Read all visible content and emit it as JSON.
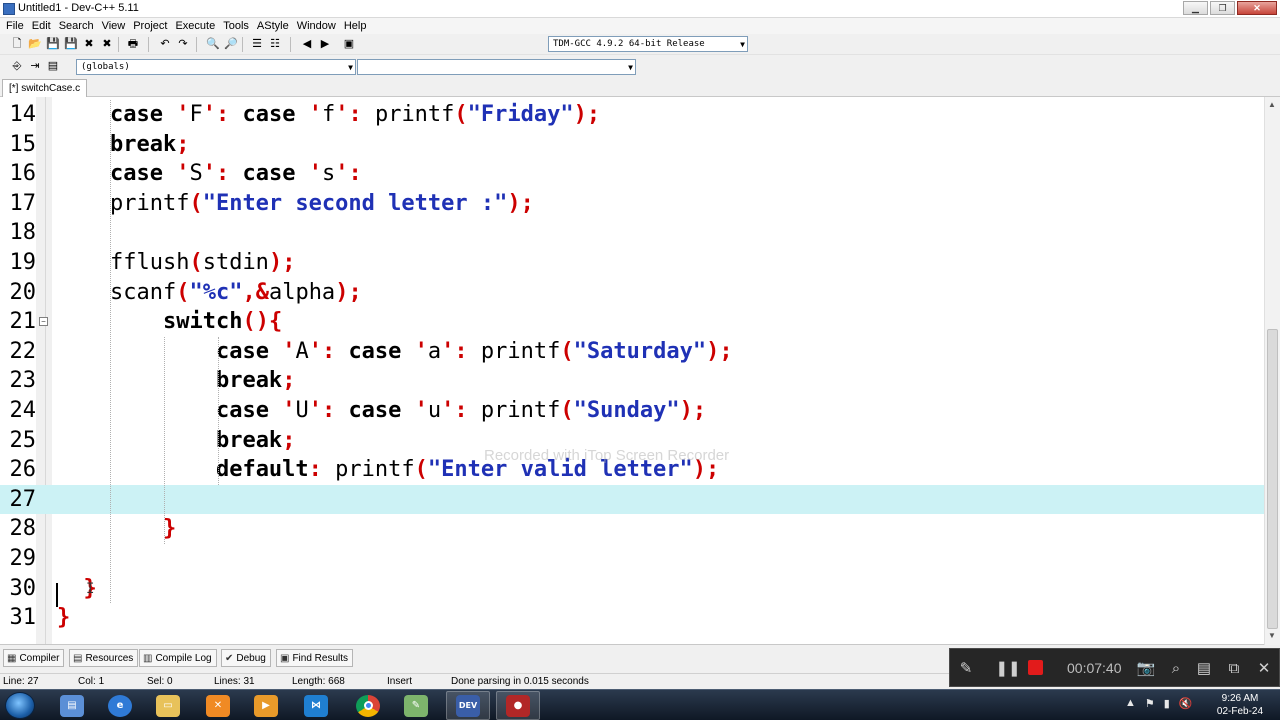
{
  "window": {
    "title": "Untitled1 - Dev-C++ 5.11"
  },
  "menu": [
    "File",
    "Edit",
    "Search",
    "View",
    "Project",
    "Execute",
    "Tools",
    "AStyle",
    "Window",
    "Help"
  ],
  "toolbar": {
    "compiler_select": "TDM-GCC 4.9.2 64-bit Release",
    "scope_select": "(globals)",
    "member_select": ""
  },
  "tab": {
    "label": "[*] switchCase.c"
  },
  "editor": {
    "current_line": 27,
    "lines": [
      {
        "n": "14",
        "text": "    case 'F': case 'f': printf(\"Friday\");"
      },
      {
        "n": "15",
        "text": "    break;"
      },
      {
        "n": "16",
        "text": "    case 'S': case 's':"
      },
      {
        "n": "17",
        "text": "    printf(\"Enter second letter :\");"
      },
      {
        "n": "18",
        "text": ""
      },
      {
        "n": "19",
        "text": "    fflush(stdin);"
      },
      {
        "n": "20",
        "text": "    scanf(\"%c\",&alpha);"
      },
      {
        "n": "21",
        "text": "        switch(){"
      },
      {
        "n": "22",
        "text": "            case 'A': case 'a': printf(\"Saturday\");"
      },
      {
        "n": "23",
        "text": "            break;"
      },
      {
        "n": "24",
        "text": "            case 'U': case 'u': printf(\"Sunday\");"
      },
      {
        "n": "25",
        "text": "            break;"
      },
      {
        "n": "26",
        "text": "            default: printf(\"Enter valid letter\");"
      },
      {
        "n": "27",
        "text": ""
      },
      {
        "n": "28",
        "text": "        }"
      },
      {
        "n": "29",
        "text": ""
      },
      {
        "n": "30",
        "text": "  }"
      },
      {
        "n": "31",
        "text": "}"
      }
    ],
    "watermark": "Recorded with iTop Screen Recorder"
  },
  "bottom_tabs": [
    "Compiler",
    "Resources",
    "Compile Log",
    "Debug",
    "Find Results"
  ],
  "recorder": {
    "time": "00:07:40"
  },
  "status": {
    "line_label": "Line:",
    "line_value": "27",
    "col_label": "Col:",
    "col_value": "1",
    "sel_label": "Sel:",
    "sel_value": "0",
    "lines_label": "Lines:",
    "lines_value": "31",
    "length_label": "Length:",
    "length_value": "668",
    "mode": "Insert",
    "message": "Done parsing in 0.015 seconds"
  },
  "taskbar": {
    "apps": [
      "explorer",
      "file",
      "ie",
      "folder",
      "xampp",
      "media",
      "vscode",
      "chrome",
      "paint",
      "devcpp",
      "recorder"
    ],
    "clock_time": "9:26 AM",
    "clock_date": "02-Feb-24"
  },
  "colors": {
    "keyword": "#000000",
    "string": "#1f31b5",
    "symbol": "#cc0000",
    "current_line": "#ccf2f5"
  }
}
